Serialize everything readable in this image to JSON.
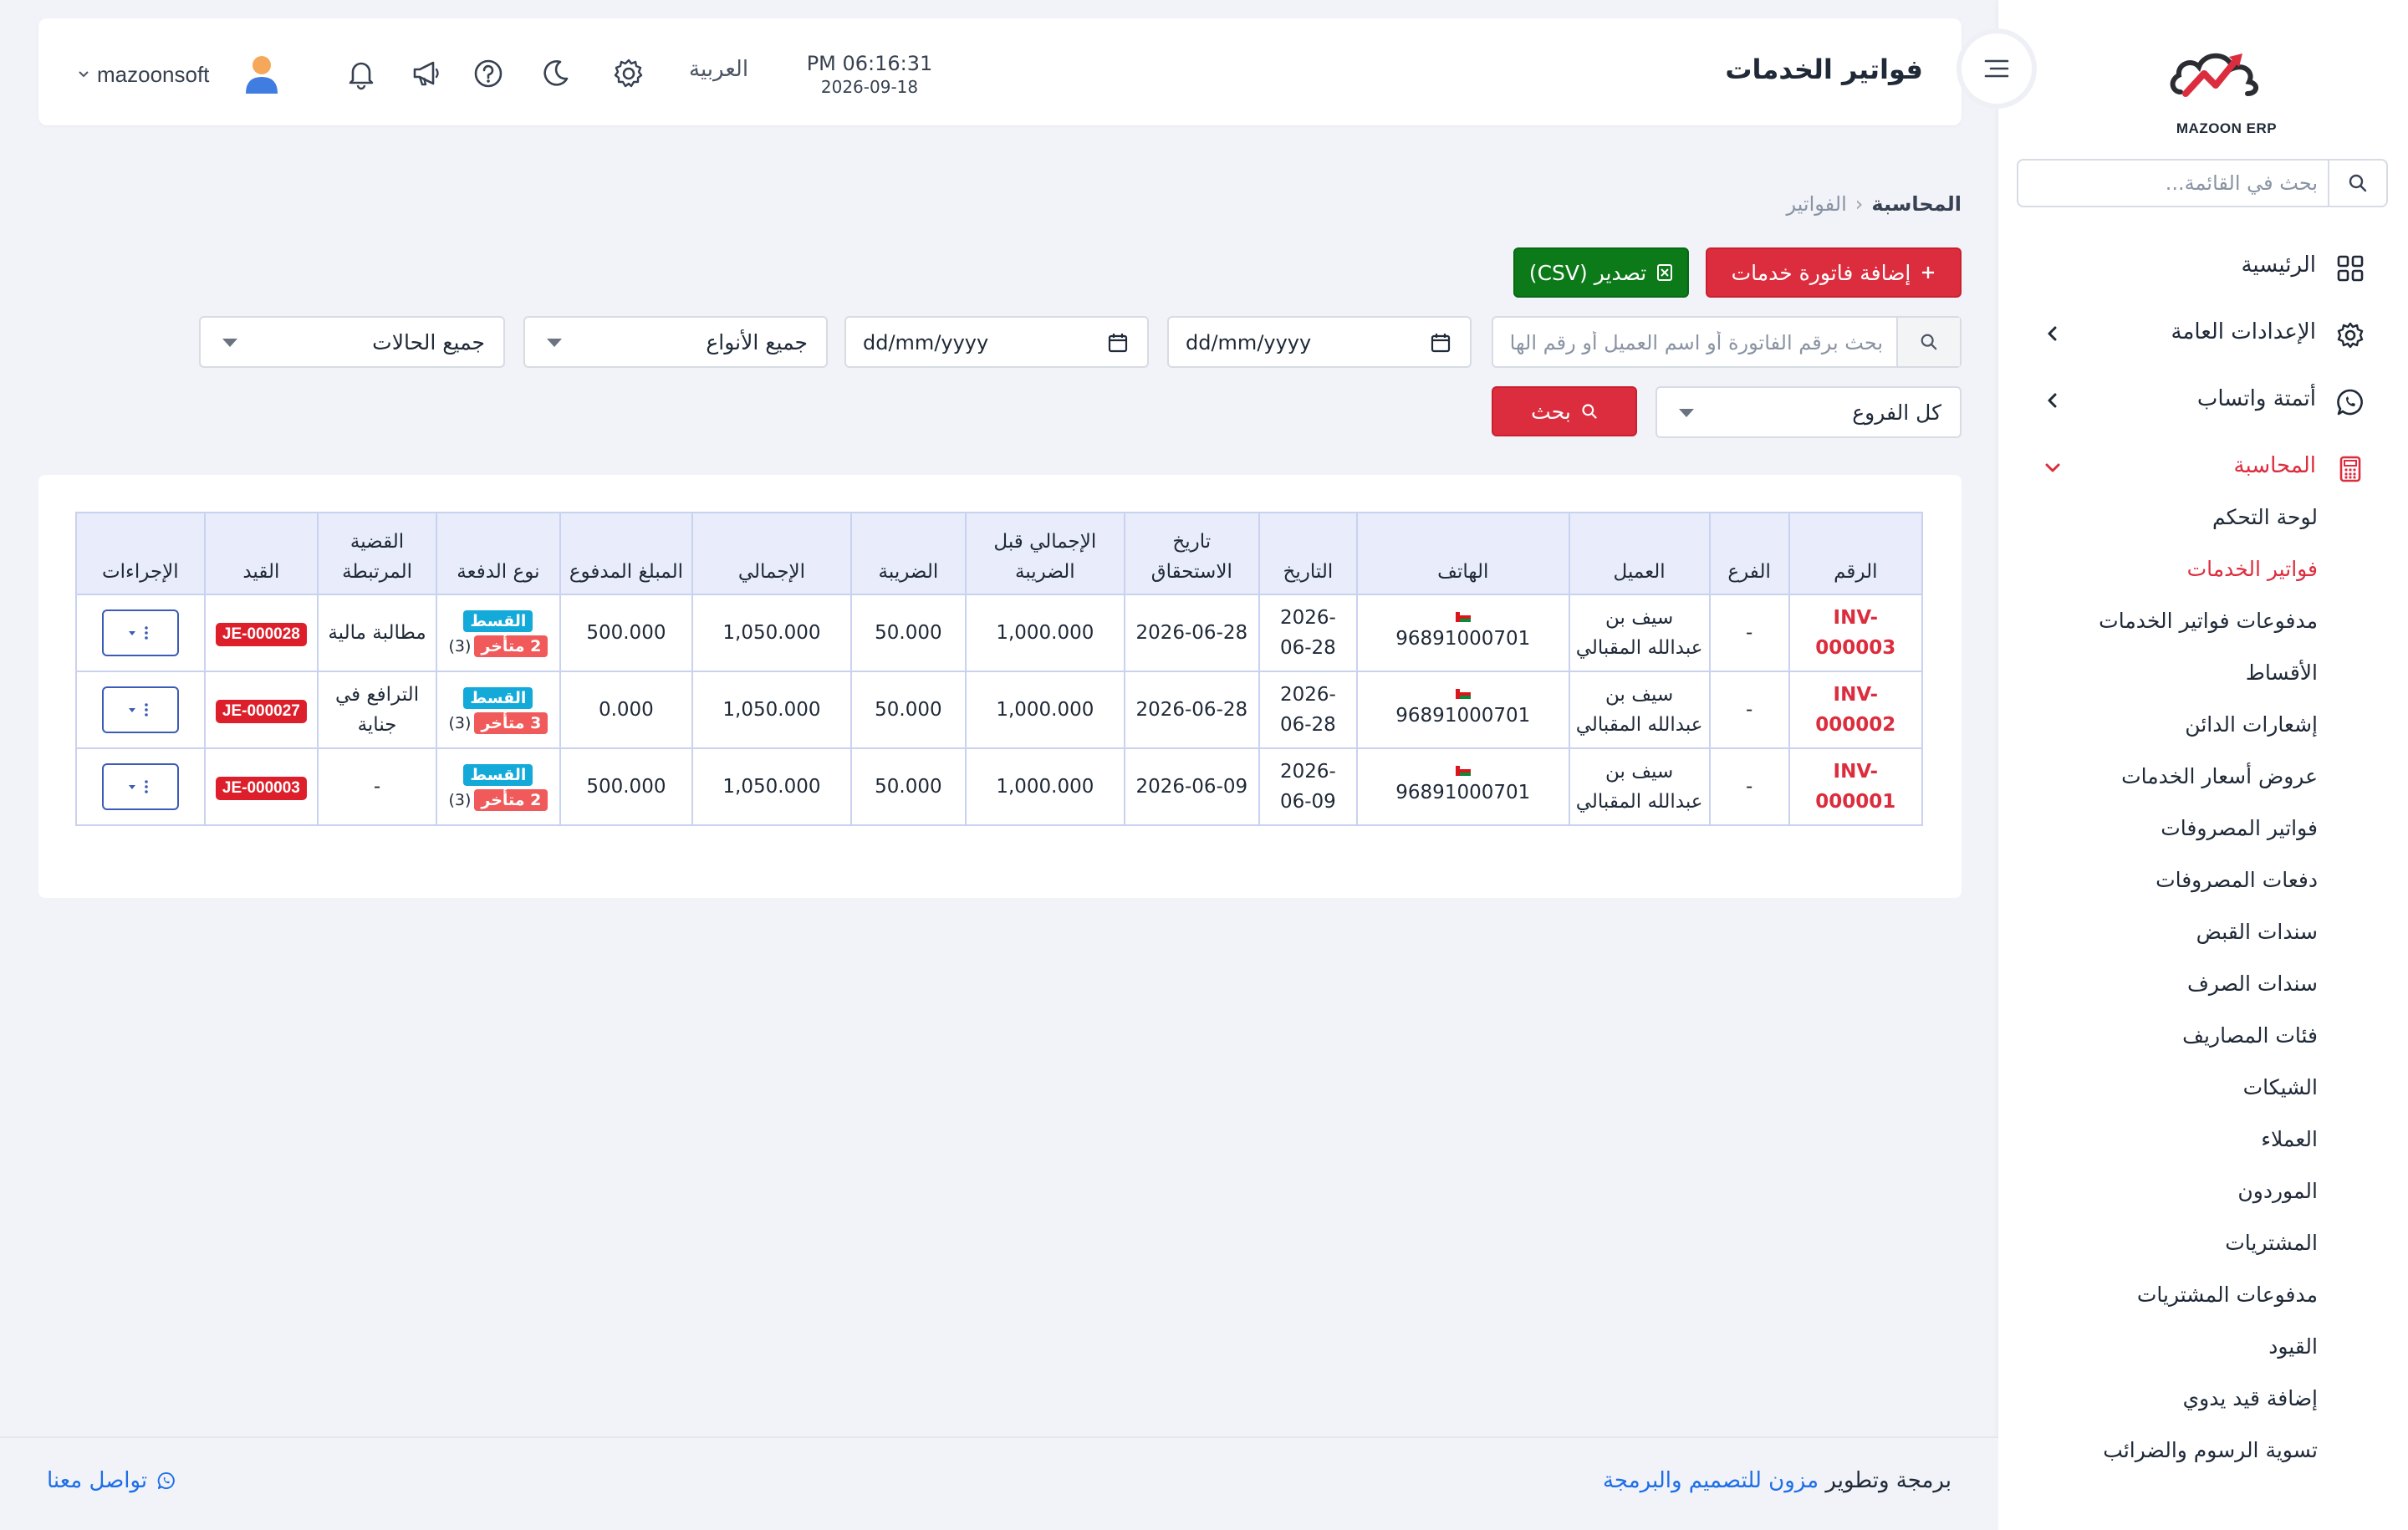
{
  "brand": {
    "logo_text": "MAZOON ERP"
  },
  "sidebar": {
    "search_placeholder": "بحث في القائمة...",
    "items": [
      {
        "label": "الرئيسية",
        "icon": "grid-icon"
      },
      {
        "label": "الإعدادات العامة",
        "icon": "gear-icon"
      },
      {
        "label": "أتمتة واتساب",
        "icon": "whatsapp-icon"
      },
      {
        "label": "المحاسبة",
        "icon": "calculator-icon"
      }
    ],
    "accounting_sub": [
      "لوحة التحكم",
      "فواتير الخدمات",
      "مدفوعات فواتير الخدمات",
      "الأقساط",
      "إشعارات الدائن",
      "عروض أسعار الخدمات",
      "فواتير المصروفات",
      "دفعات المصروفات",
      "سندات القبض",
      "سندات الصرف",
      "فئات المصاريف",
      "الشيكات",
      "العملاء",
      "الموردون",
      "المشتريات",
      "مدفوعات المشتريات",
      "القيود",
      "إضافة قيد يدوي",
      "تسوية الرسوم والضرائب"
    ],
    "active_sub_index": 1
  },
  "header": {
    "title": "فواتير الخدمات",
    "time": "PM 06:16:31",
    "date": "2026-09-18",
    "language": "العربية",
    "username": "mazoonsoft"
  },
  "breadcrumb": {
    "root": "المحاسبة",
    "current": "الفواتير"
  },
  "actions": {
    "add_label": "إضافة فاتورة خدمات",
    "export_label": "تصدير (CSV)"
  },
  "filters": {
    "search_placeholder": "بحث برقم الفاتورة أو اسم العميل أو رقم الهاتف",
    "date_from": "dd/mm/yyyy",
    "date_to": "dd/mm/yyyy",
    "type": "جميع الأنواع",
    "status": "جميع الحالات",
    "branch": "كل الفروع",
    "search_button": "بحث"
  },
  "table": {
    "headers": {
      "number": "الرقم",
      "branch": "الفرع",
      "client": "العميل",
      "phone": "الهاتف",
      "date": "التاريخ",
      "due_date": "تاريخ الاستحقاق",
      "subtotal": "الإجمالي قبل الضريبة",
      "tax": "الضريبة",
      "total": "الإجمالي",
      "paid": "المبلغ المدفوع",
      "payment_type": "نوع الدفعة",
      "case": "القضية المرتبطة",
      "entry": "القيد",
      "actions": "الإجراءات"
    },
    "rows": [
      {
        "number": "INV-000003",
        "branch": "-",
        "client": "سيف بن عبدالله المقبالي",
        "phone": "96891000701",
        "date": "2026-06-28",
        "due_date": "2026-06-28",
        "subtotal": "1,000.000",
        "tax": "50.000",
        "total": "1,050.000",
        "paid": "500.000",
        "pay_badge": "القسط",
        "overdue": "2 متأخر",
        "count": "(3)",
        "case": "مطالبة مالية",
        "entry": "JE-000028"
      },
      {
        "number": "INV-000002",
        "branch": "-",
        "client": "سيف بن عبدالله المقبالي",
        "phone": "96891000701",
        "date": "2026-06-28",
        "due_date": "2026-06-28",
        "subtotal": "1,000.000",
        "tax": "50.000",
        "total": "1,050.000",
        "paid": "0.000",
        "pay_badge": "القسط",
        "overdue": "3 متأخر",
        "count": "(3)",
        "case": "الترافع في جناية",
        "entry": "JE-000027"
      },
      {
        "number": "INV-000001",
        "branch": "-",
        "client": "سيف بن عبدالله المقبالي",
        "phone": "96891000701",
        "date": "2026-06-09",
        "due_date": "2026-06-09",
        "subtotal": "1,000.000",
        "tax": "50.000",
        "total": "1,050.000",
        "paid": "500.000",
        "pay_badge": "القسط",
        "overdue": "2 متأخر",
        "count": "(3)",
        "case": "-",
        "entry": "JE-000003"
      }
    ]
  },
  "footer": {
    "prefix": "برمجة وتطوير",
    "company": "مزون للتصميم والبرمجة",
    "contact": "تواصل معنا"
  },
  "colors": {
    "accent": "#dc2d3e",
    "export": "#0c7a19",
    "link": "#1e6ee8",
    "badge_blue": "#13a9d9"
  }
}
